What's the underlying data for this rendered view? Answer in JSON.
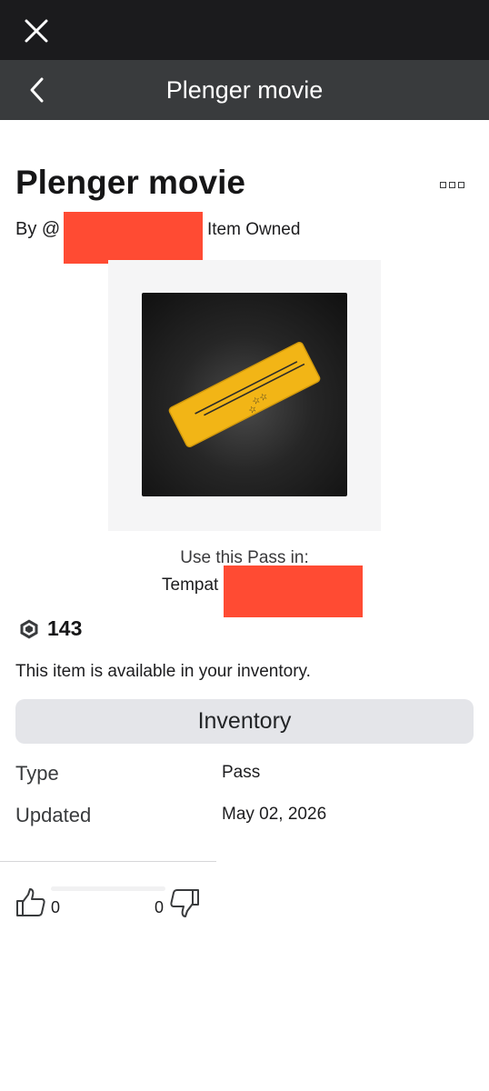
{
  "top_bar": {
    "close_icon": "close-icon"
  },
  "nav": {
    "back_icon": "chevron-left-icon",
    "title": "Plenger movie"
  },
  "item": {
    "title": "Plenger movie",
    "more_icon": "more-options-icon",
    "by_prefix": "By @",
    "owned_label": "Item Owned",
    "thumbnail_icon": "ticket-icon"
  },
  "use_pass": {
    "label": "Use this Pass in:",
    "place_prefix": "Tempat"
  },
  "price": {
    "icon": "robux-icon",
    "value": "143"
  },
  "availability": "This item is available in your inventory.",
  "inventory_button": "Inventory",
  "details": [
    {
      "label": "Type",
      "value": "Pass"
    },
    {
      "label": "Updated",
      "value": "May 02, 2026"
    }
  ],
  "votes": {
    "up_count": "0",
    "down_count": "0",
    "up_icon": "thumbs-up-icon",
    "down_icon": "thumbs-down-icon"
  },
  "colors": {
    "redaction": "#ff4b33",
    "ticket": "#f2b516",
    "top_bar": "#1b1b1d",
    "nav_bar": "#393b3d"
  }
}
